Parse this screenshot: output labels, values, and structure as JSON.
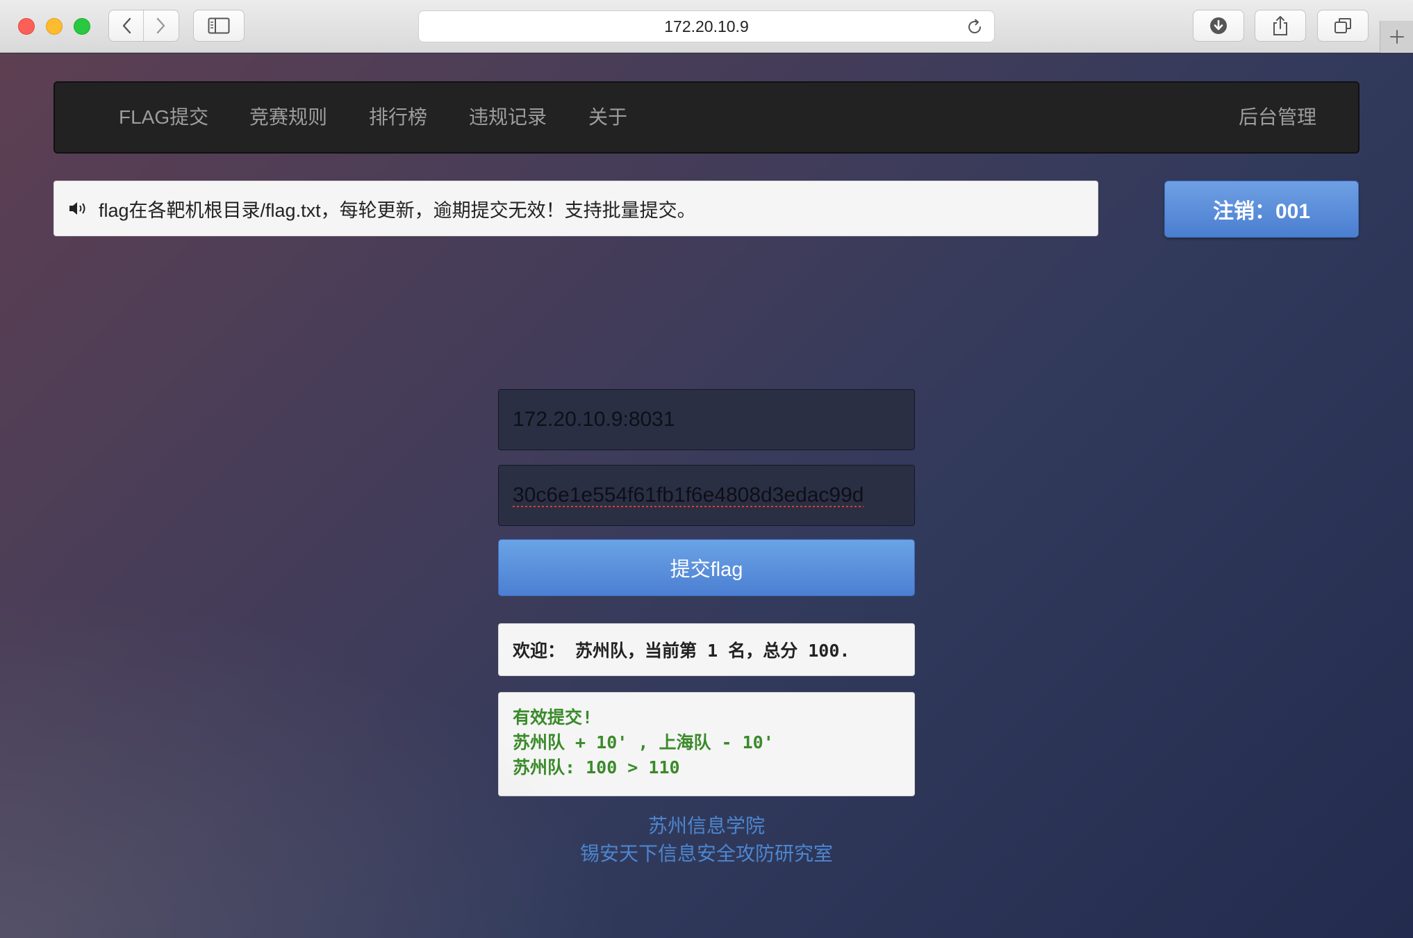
{
  "browser": {
    "url": "172.20.10.9"
  },
  "navbar": {
    "items": [
      {
        "label": "FLAG提交"
      },
      {
        "label": "竞赛规则"
      },
      {
        "label": "排行榜"
      },
      {
        "label": "违规记录"
      },
      {
        "label": "关于"
      }
    ],
    "admin_label": "后台管理"
  },
  "notice": {
    "text": "flag在各靶机根目录/flag.txt，每轮更新，逾期提交无效！支持批量提交。"
  },
  "logout_button": {
    "label": "注销：001"
  },
  "form": {
    "target_value": "172.20.10.9:8031",
    "flag_value": "30c6e1e554f61fb1f6e4808d3edac99d",
    "submit_label": "提交flag"
  },
  "welcome": {
    "text": "欢迎： 苏州队，当前第 1 名，总分 100."
  },
  "result": {
    "line1": "有效提交!",
    "line2": "苏州队 + 10' , 上海队 - 10'",
    "line3": "苏州队: 100 > 110"
  },
  "footer": {
    "line1": "苏州信息学院",
    "line2": "锡安天下信息安全攻防研究室"
  },
  "colors": {
    "accent": "#4a7ed0",
    "success": "#3a8a2a",
    "link": "#4c86d0"
  }
}
